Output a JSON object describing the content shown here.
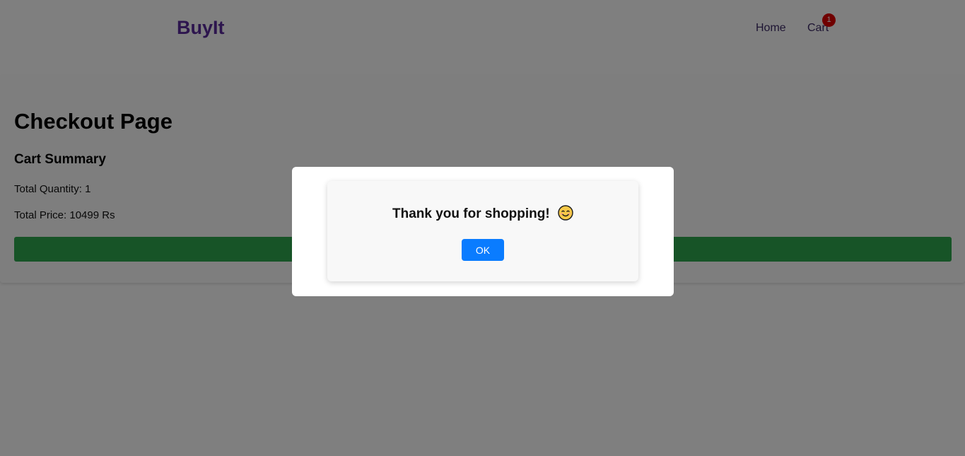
{
  "header": {
    "brand": "BuyIt",
    "nav": {
      "home": "Home",
      "cart": "Cart",
      "cart_count": "1"
    }
  },
  "checkout": {
    "title": "Checkout Page",
    "summary_title": "Cart Summary",
    "total_quantity_label": "Total Quantity: ",
    "total_quantity_value": "1",
    "total_price_label": "Total Price: ",
    "total_price_value": "10499 Rs"
  },
  "modal": {
    "message": "Thank you for shopping!",
    "emoji_icon": "smiling-face-icon",
    "ok_label": "OK"
  },
  "colors": {
    "brand": "#5a2a9c",
    "badge": "#e00000",
    "checkout_button": "#2fa84f",
    "ok_button": "#0a7cff"
  }
}
